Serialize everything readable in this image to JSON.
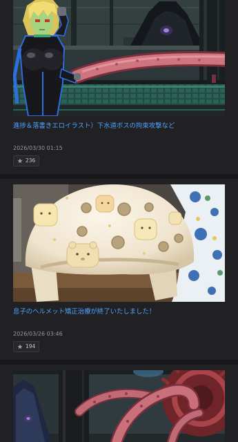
{
  "feed": {
    "posts": [
      {
        "title": "進捗＆落書きエロイラスト）下水道ボスの拘束攻撃など",
        "date": "2026/03/30 01:15",
        "likes": "236"
      },
      {
        "title": "息子のヘルメット矯正治療が終了いたしました！",
        "date": "2026/03/26 03:46",
        "likes": "194"
      }
    ]
  },
  "icons": {
    "like": "star-icon"
  },
  "colors": {
    "background": "#18181a",
    "card": "#212124",
    "title_link": "#4da3ff",
    "date_text": "#9a9a9e",
    "badge_text": "#c8c8cc",
    "badge_bg": "#28282b",
    "badge_border": "#3a3a3e",
    "icon": "#9a9a9e"
  }
}
